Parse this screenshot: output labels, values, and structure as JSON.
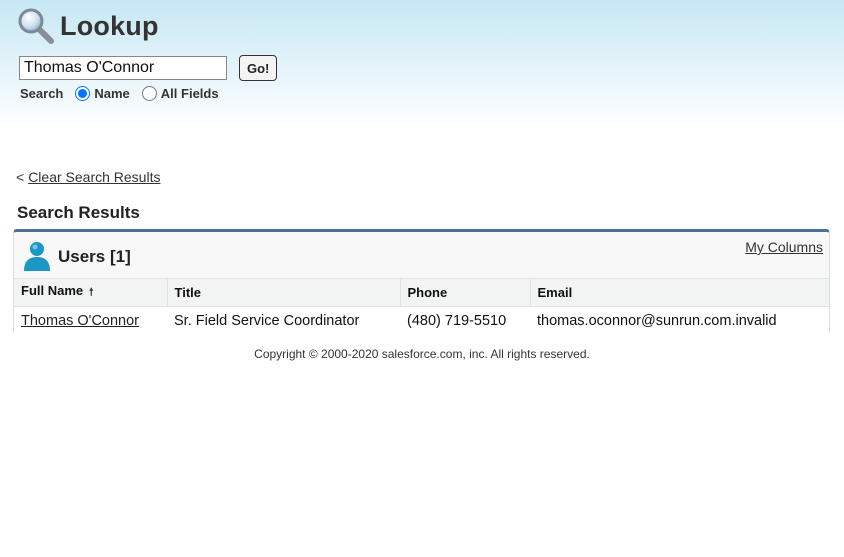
{
  "header": {
    "title": "Lookup",
    "icon": "magnifier-icon"
  },
  "search": {
    "value": "Thomas O'Connor",
    "go_label": "Go!",
    "scope_label": "Search",
    "options": [
      {
        "label": "Name",
        "selected": true
      },
      {
        "label": "All Fields",
        "selected": false
      }
    ]
  },
  "clear": {
    "prefix": "<",
    "label": "Clear Search Results"
  },
  "results": {
    "heading": "Search Results",
    "panel_title": "Users [1]",
    "my_columns": "My Columns",
    "columns": [
      {
        "label": "Full Name",
        "sort": "ascending"
      },
      {
        "label": "Title"
      },
      {
        "label": "Phone"
      },
      {
        "label": "Email"
      }
    ],
    "rows": [
      {
        "full_name": "Thomas O'Connor",
        "title": "Sr. Field Service Coordinator",
        "phone": "(480) 719-5510",
        "email": "thomas.oconnor@sunrun.com.invalid"
      }
    ]
  },
  "footer": {
    "copyright": "Copyright © 2000-2020 salesforce.com, inc. All rights reserved."
  },
  "colors": {
    "panel_border": "#4d6f94",
    "header_gradient": "#c6e7f4",
    "user_icon": "#1b96c5"
  }
}
